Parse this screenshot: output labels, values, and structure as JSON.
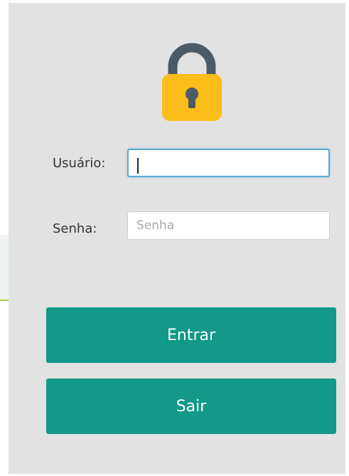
{
  "colors": {
    "panel_background": "#e2e2e2",
    "button_background": "#12998a",
    "button_text": "#ffffff",
    "lock_body": "#fbbd1a",
    "lock_shackle": "#4d5b67",
    "focus_border": "#5fa8d3"
  },
  "header": {
    "icon": "lock-icon"
  },
  "login_form": {
    "username": {
      "label": "Usuário:",
      "value": "",
      "focused": true
    },
    "password": {
      "label": "Senha:",
      "value": "",
      "placeholder": "Senha"
    },
    "submit_label": "Entrar",
    "exit_label": "Sair"
  }
}
